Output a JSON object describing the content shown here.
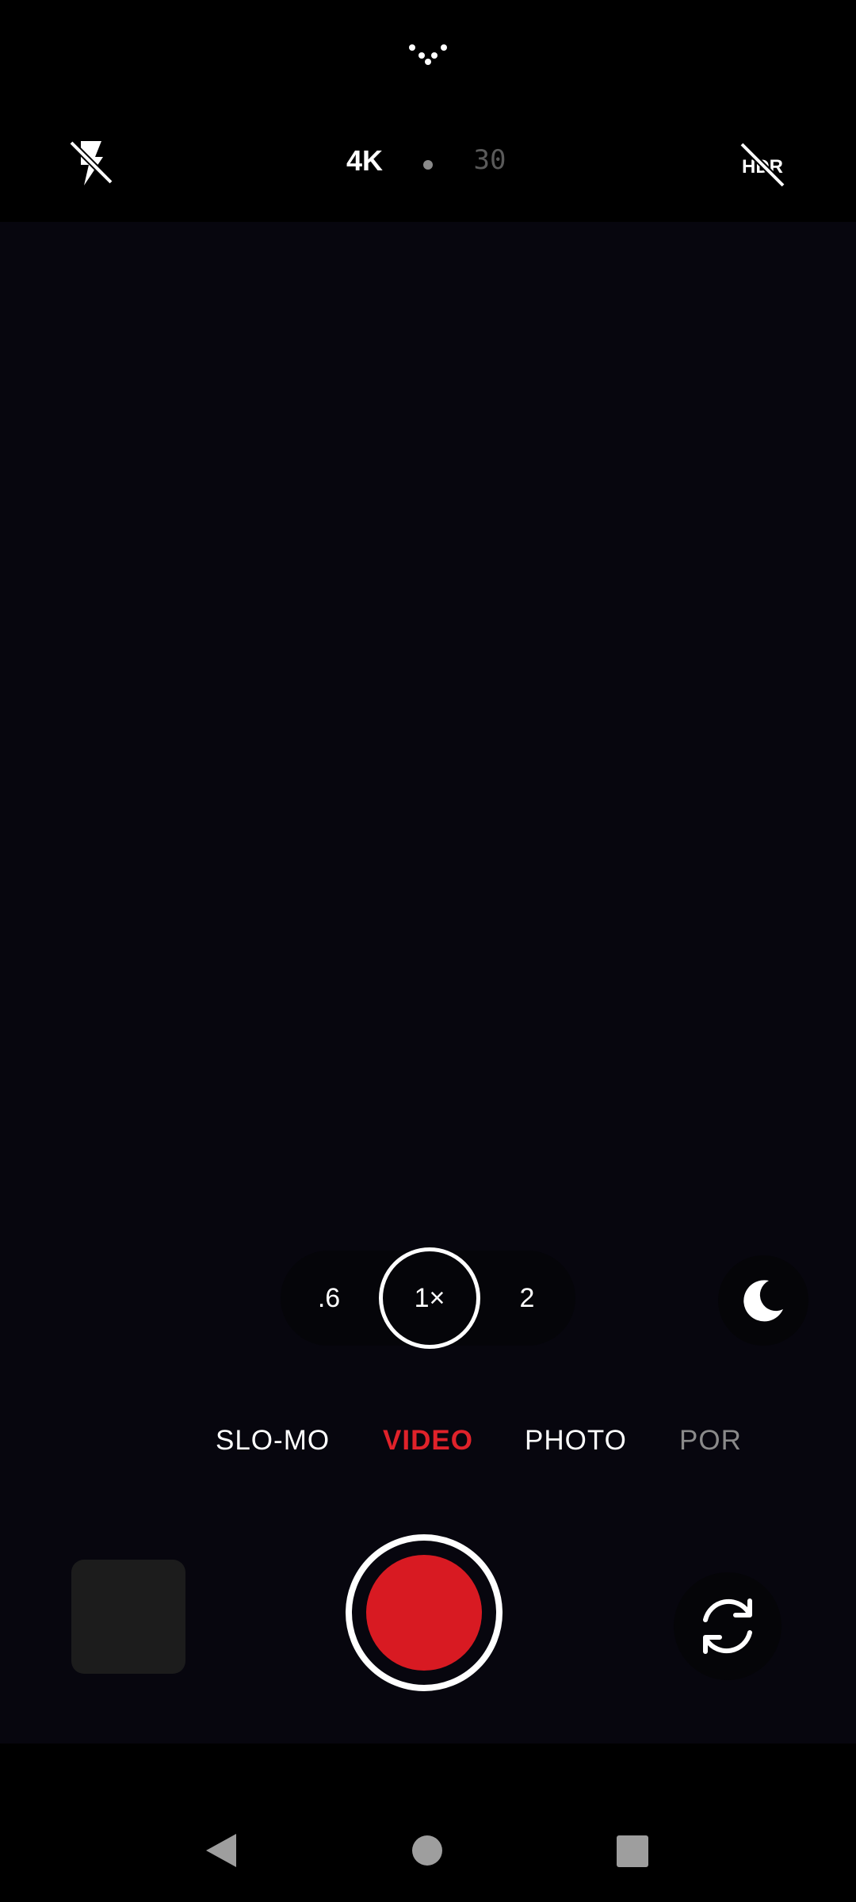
{
  "top_bar": {
    "resolution": "4K",
    "fps": "30",
    "icons": {
      "more": "more-dots-icon",
      "flash": "flash-off-icon",
      "hdr": "hdr-off-icon"
    }
  },
  "zoom": {
    "options": [
      ".6",
      "1×",
      "2"
    ],
    "selected": "1×"
  },
  "modes": {
    "slomo": "SLO-MO",
    "video": "VIDEO",
    "photo": "PHOTO",
    "portrait_partial": "POR",
    "selected": "VIDEO"
  },
  "bottom": {
    "icons": {
      "gallery": "gallery-thumbnail",
      "shutter": "record-icon",
      "switch": "switch-camera-icon",
      "night": "night-mode-icon"
    }
  },
  "colors": {
    "accent": "#e0222a",
    "record": "#d81a22",
    "viewfinder": "#07060e"
  }
}
